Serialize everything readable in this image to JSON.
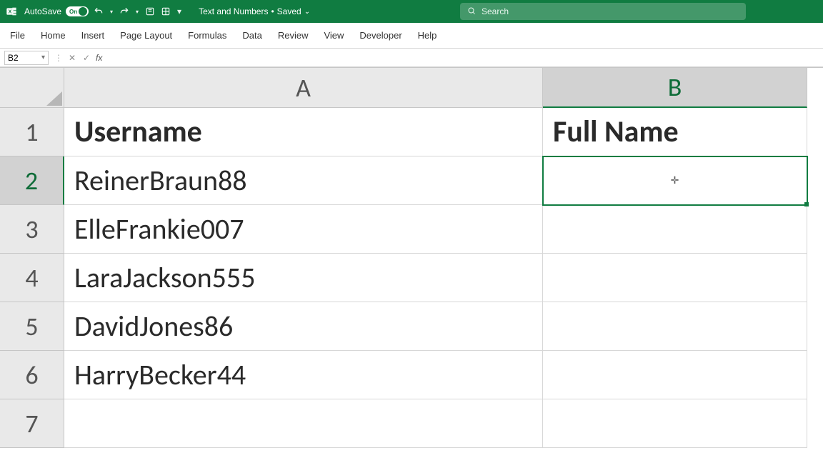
{
  "title_bar": {
    "autosave_label": "AutoSave",
    "autosave_on": "On",
    "doc_name": "Text and Numbers",
    "doc_status": "Saved",
    "search_placeholder": "Search"
  },
  "ribbon": {
    "tabs": [
      "File",
      "Home",
      "Insert",
      "Page Layout",
      "Formulas",
      "Data",
      "Review",
      "View",
      "Developer",
      "Help"
    ]
  },
  "formula_bar": {
    "name_box": "B2",
    "fx_label": "fx",
    "value": ""
  },
  "grid": {
    "col_headers": [
      "A",
      "B"
    ],
    "row_headers": [
      "1",
      "2",
      "3",
      "4",
      "5",
      "6",
      "7"
    ],
    "selected_col": "B",
    "selected_row": "2",
    "active_cell": "B2",
    "cells": {
      "A1": "Username",
      "B1": "Full Name",
      "A2": "ReinerBraun88",
      "A3": "ElleFrankie007",
      "A4": "LaraJackson555",
      "A5": "DavidJones86",
      "A6": "HarryBecker44",
      "A7": "",
      "B2": "",
      "B3": "",
      "B4": "",
      "B5": "",
      "B6": "",
      "B7": ""
    }
  }
}
